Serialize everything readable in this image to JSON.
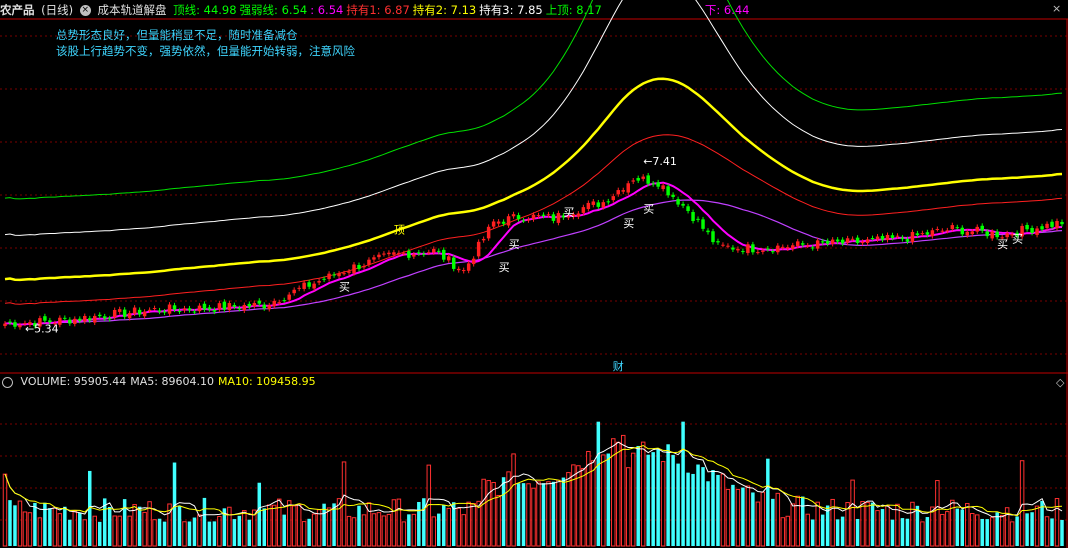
{
  "header": {
    "product": "农产品",
    "period": "(日线)",
    "indicator": "成本轨道解盘",
    "items": [
      {
        "label": "顶线:",
        "value": "44.98",
        "color": "#00ff00"
      },
      {
        "label": "强弱线:",
        "value": "6.54",
        "color": "#00ff00"
      },
      {
        "label": ":",
        "value": "6.54",
        "color": "#ff00ff"
      },
      {
        "label": "持有1:",
        "value": "6.87",
        "color": "#ff3030"
      },
      {
        "label": "持有2:",
        "value": "7.13",
        "color": "#ffff00"
      },
      {
        "label": "持有3:",
        "value": "7.85",
        "color": "#ffffff"
      },
      {
        "label": "上顶:",
        "value": "8.17",
        "color": "#00ff00"
      },
      {
        "label": "下:",
        "value": "6.44",
        "color": "#ff00ff"
      }
    ]
  },
  "notes": [
    "总势形态良好，但量能稍显不足，随时准备减仓",
    "该股上行趋势不变，强势依然，但量能开始转弱，注意风险"
  ],
  "volume_header": {
    "items": [
      {
        "label": "VOLUME:",
        "value": "95905.44",
        "color": "#e0e0e0"
      },
      {
        "label": "MA5:",
        "value": "89604.10",
        "color": "#e0e0e0"
      },
      {
        "label": "MA10:",
        "value": "109458.95",
        "color": "#ffff00"
      }
    ]
  },
  "controls": {
    "close": "×",
    "diamond": "◇"
  },
  "chart_data": {
    "type": "candlestick",
    "price_range": [
      4.9,
      9.2
    ],
    "volume_range": [
      0,
      160000
    ],
    "anchors": [
      {
        "i": 0,
        "close": 5.45
      },
      {
        "i": 10,
        "close": 5.48
      },
      {
        "i": 20,
        "close": 5.55
      },
      {
        "i": 30,
        "close": 5.62
      },
      {
        "i": 40,
        "close": 5.64
      },
      {
        "i": 52,
        "close": 5.68
      },
      {
        "i": 60,
        "close": 5.9
      },
      {
        "i": 70,
        "close": 6.15
      },
      {
        "i": 78,
        "close": 6.3
      },
      {
        "i": 86,
        "close": 6.35
      },
      {
        "i": 92,
        "close": 6.1
      },
      {
        "i": 98,
        "close": 6.7
      },
      {
        "i": 104,
        "close": 6.78
      },
      {
        "i": 110,
        "close": 6.75
      },
      {
        "i": 114,
        "close": 6.85
      },
      {
        "i": 120,
        "close": 6.95
      },
      {
        "i": 126,
        "close": 7.25
      },
      {
        "i": 131,
        "close": 7.2
      },
      {
        "i": 137,
        "close": 6.85
      },
      {
        "i": 143,
        "close": 6.4
      },
      {
        "i": 150,
        "close": 6.38
      },
      {
        "i": 160,
        "close": 6.42
      },
      {
        "i": 170,
        "close": 6.45
      },
      {
        "i": 180,
        "close": 6.5
      },
      {
        "i": 190,
        "close": 6.62
      },
      {
        "i": 200,
        "close": 6.55
      },
      {
        "i": 212,
        "close": 6.7
      }
    ],
    "bar_count": 213,
    "labels": [
      {
        "text": "←5.34",
        "i": 4,
        "price": 5.34,
        "color": "#ffffff"
      },
      {
        "text": "←7.41",
        "i": 128,
        "price": 7.41,
        "color": "#ffffff"
      },
      {
        "text": "买",
        "i": 67,
        "price": 5.86,
        "color": "#ffffff"
      },
      {
        "text": "买",
        "i": 101,
        "price": 6.38,
        "color": "#ffffff"
      },
      {
        "text": "买",
        "i": 112,
        "price": 6.78,
        "color": "#ffffff"
      },
      {
        "text": "买",
        "i": 124,
        "price": 6.64,
        "color": "#ffffff"
      },
      {
        "text": "买",
        "i": 128,
        "price": 6.82,
        "color": "#ffffff"
      },
      {
        "text": "买",
        "i": 99,
        "price": 6.1,
        "color": "#ffffff"
      },
      {
        "text": "买",
        "i": 199,
        "price": 6.38,
        "color": "#ffffff"
      },
      {
        "text": "买",
        "i": 202,
        "price": 6.45,
        "color": "#ffffff"
      },
      {
        "text": "顶",
        "i": 78,
        "price": 6.56,
        "color": "#ffff00"
      }
    ],
    "event_label": {
      "text": "财",
      "i": 123,
      "color": "#3fd6ff"
    },
    "bands": [
      {
        "name": "green",
        "offset": 1.55,
        "color": "#00e000",
        "hump": 2.1
      },
      {
        "name": "white",
        "offset": 1.1,
        "color": "#ffffff",
        "hump": 1.7
      },
      {
        "name": "yellow",
        "offset": 0.55,
        "color": "#ffff00",
        "hump": 0.9
      },
      {
        "name": "red",
        "offset": 0.25,
        "color": "#ff2020",
        "hump": 0.5
      }
    ],
    "colors": {
      "up": "#ff2020",
      "down": "#00ff00",
      "big": "#ffff00",
      "ma_fast": "#ff00ff",
      "ma_slow": "#c040ff",
      "vol_up": "#ff3030",
      "vol_down": "#40ffff",
      "vol_ma5": "#ffffff",
      "vol_ma10": "#ffff00",
      "grid": "#7a0000",
      "border": "#c00000"
    }
  }
}
